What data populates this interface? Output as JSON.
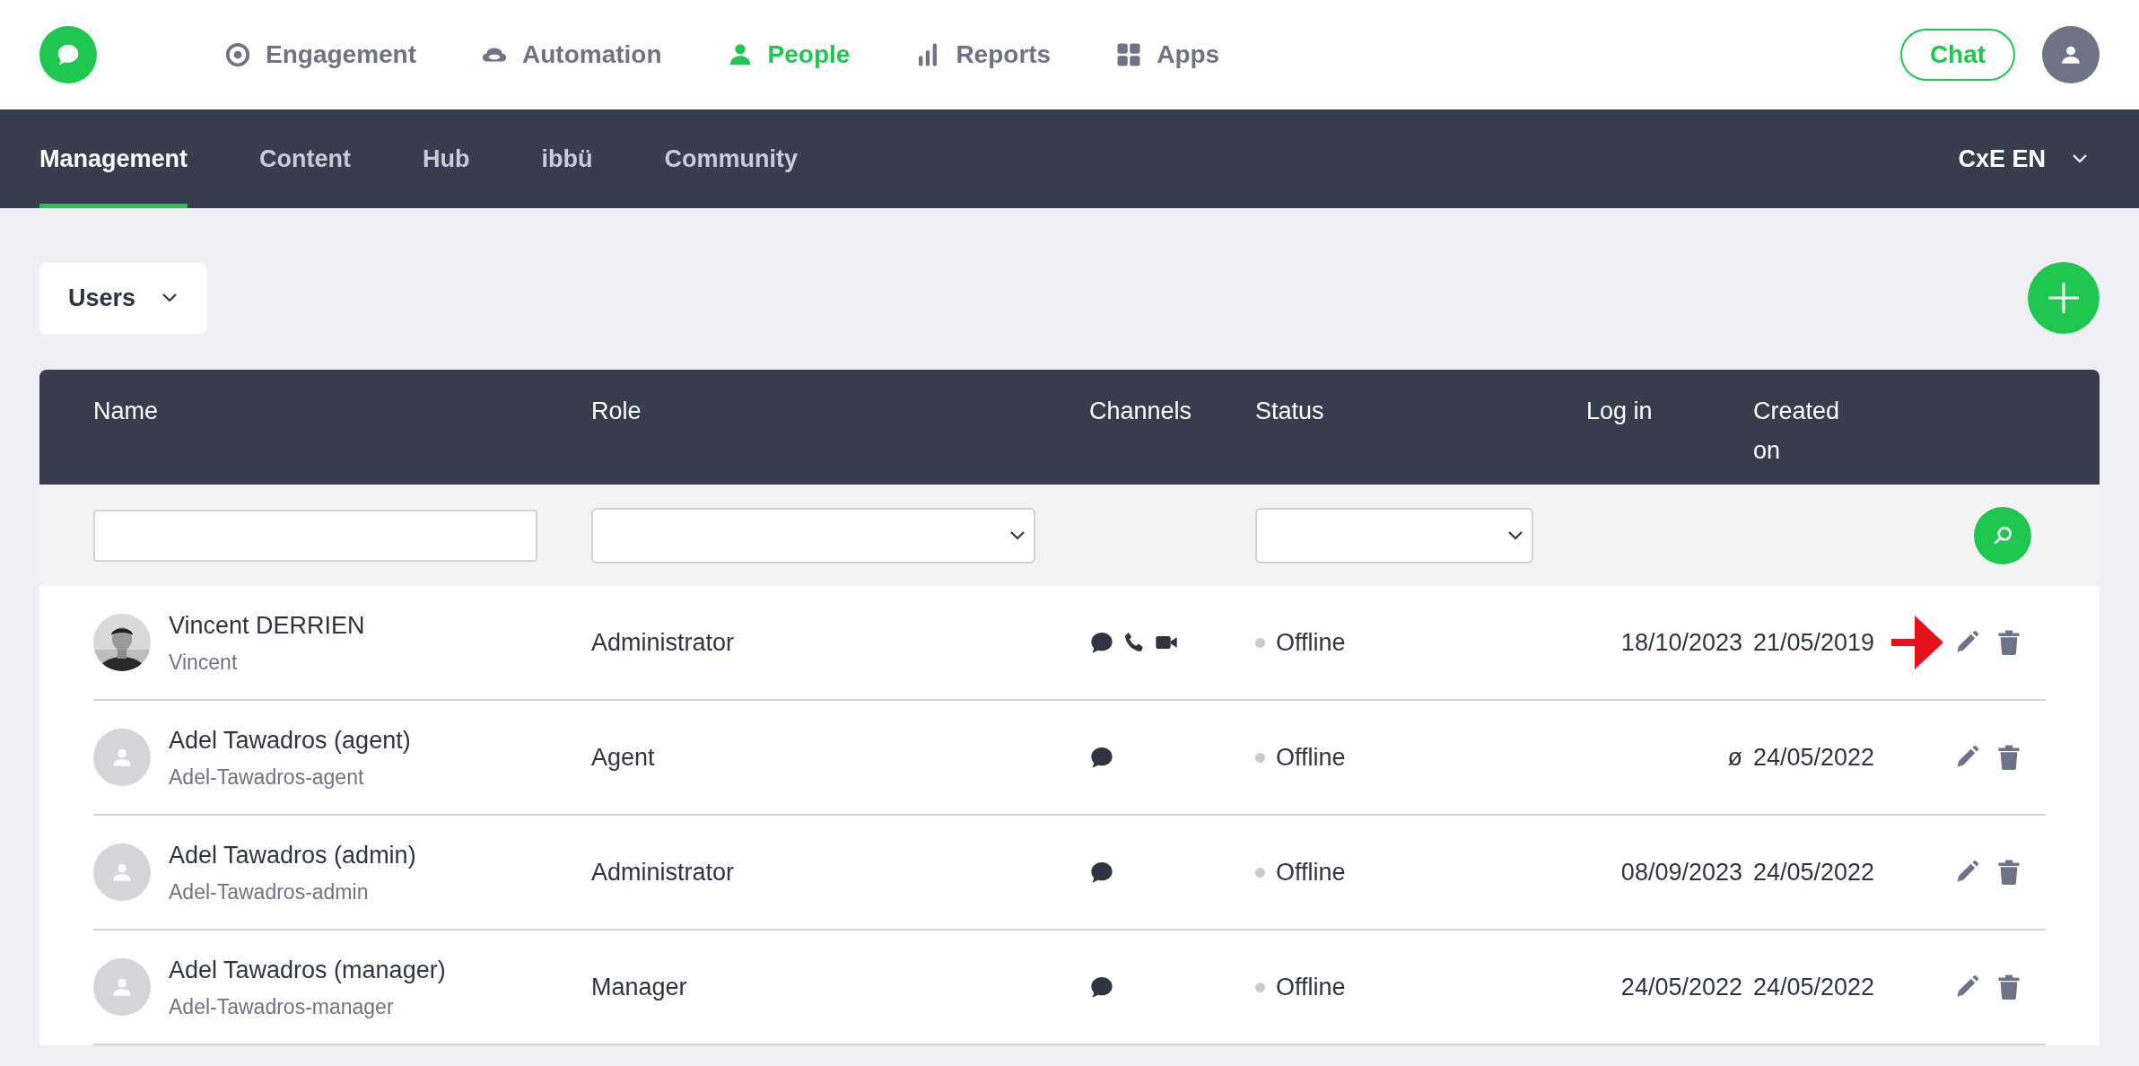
{
  "nav": [
    {
      "label": "Engagement",
      "kind": "target",
      "selected": false
    },
    {
      "label": "Automation",
      "kind": "cloud",
      "selected": false
    },
    {
      "label": "People",
      "kind": "person",
      "selected": true
    },
    {
      "label": "Reports",
      "kind": "bars",
      "selected": false
    },
    {
      "label": "Apps",
      "kind": "grid",
      "selected": false
    }
  ],
  "chat_button": "Chat",
  "tabs": [
    {
      "label": "Management",
      "selected": true
    },
    {
      "label": "Content",
      "selected": false
    },
    {
      "label": "Hub",
      "selected": false
    },
    {
      "label": "ibbü",
      "selected": false
    },
    {
      "label": "Community",
      "selected": false
    }
  ],
  "workspace": "CxE EN",
  "view_select": "Users",
  "table": {
    "columns": [
      "Name",
      "Role",
      "Channels",
      "Status",
      "Log in",
      "Created on"
    ],
    "rows": [
      {
        "name": "Vincent DERRIEN",
        "username": "Vincent",
        "photo": true,
        "role": "Administrator",
        "channels": [
          {
            "kind": "chat"
          },
          {
            "kind": "phone"
          },
          {
            "kind": "video"
          }
        ],
        "status": "Offline",
        "login": "18/10/2023",
        "created": "21/05/2019",
        "highlighted": true
      },
      {
        "name": "Adel Tawadros (agent)",
        "username": "Adel-Tawadros-agent",
        "photo": false,
        "role": "Agent",
        "channels": [
          {
            "kind": "chat"
          }
        ],
        "status": "Offline",
        "login": "ø",
        "created": "24/05/2022",
        "highlighted": false
      },
      {
        "name": "Adel Tawadros (admin)",
        "username": "Adel-Tawadros-admin",
        "photo": false,
        "role": "Administrator",
        "channels": [
          {
            "kind": "chat"
          }
        ],
        "status": "Offline",
        "login": "08/09/2023",
        "created": "24/05/2022",
        "highlighted": false
      },
      {
        "name": "Adel Tawadros (manager)",
        "username": "Adel-Tawadros-manager",
        "photo": false,
        "role": "Manager",
        "channels": [
          {
            "kind": "chat"
          }
        ],
        "status": "Offline",
        "login": "24/05/2022",
        "created": "24/05/2022",
        "highlighted": false
      }
    ]
  }
}
